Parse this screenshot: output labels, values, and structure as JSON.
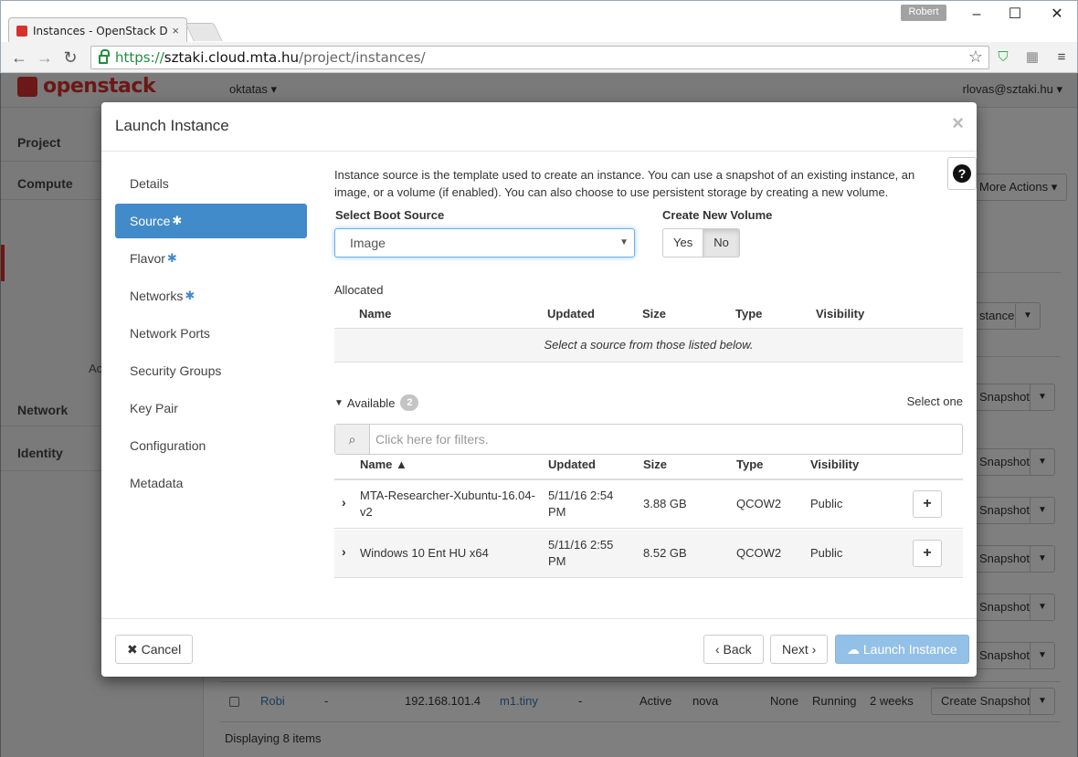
{
  "browser": {
    "tab_title": "Instances - OpenStack Da",
    "tab_close": "×",
    "profile": "Robert",
    "url_proto": "https://",
    "url_host": "sztaki.cloud.mta.hu",
    "url_path": "/project/instances/",
    "icons": [
      "back-arrow-icon",
      "forward-arrow-icon",
      "reload-icon",
      "lock-icon",
      "star-icon",
      "shield-icon",
      "extension-icon",
      "menu-icon"
    ]
  },
  "app": {
    "brand": "openstack",
    "project_switch": "oktatas ▾",
    "user": "rlovas@sztaki.hu ▾",
    "sidebar": {
      "project": "Project",
      "compute": "Compute",
      "network": "Network",
      "identity": "Identity",
      "stub": "Ac"
    },
    "more_actions": "More Actions ▾",
    "launch_stub": "stance",
    "create_snapshot": "Create Snapshot",
    "snapshot": "Snapshot",
    "last_row": {
      "name": "Robi",
      "image": "-",
      "ip": "192.168.101.4",
      "flavor": "m1.tiny",
      "keypair": "-",
      "status": "Active",
      "zone": "nova",
      "task": "None",
      "power": "Running",
      "age": "2 weeks"
    },
    "footer": "Displaying 8 items"
  },
  "modal": {
    "title": "Launch Instance",
    "close": "×",
    "help": "?",
    "nav": [
      {
        "label": "Details",
        "required": false
      },
      {
        "label": "Source",
        "required": true
      },
      {
        "label": "Flavor",
        "required": true
      },
      {
        "label": "Networks",
        "required": true
      },
      {
        "label": "Network Ports",
        "required": false
      },
      {
        "label": "Security Groups",
        "required": false
      },
      {
        "label": "Key Pair",
        "required": false
      },
      {
        "label": "Configuration",
        "required": false
      },
      {
        "label": "Metadata",
        "required": false
      }
    ],
    "active_step": "Source",
    "intro": "Instance source is the template used to create an instance. You can use a snapshot of an existing instance, an image, or a volume (if enabled). You can also choose to use persistent storage by creating a new volume.",
    "boot_source_label": "Select Boot Source",
    "boot_source_value": "Image",
    "create_volume_label": "Create New Volume",
    "volume_yes": "Yes",
    "volume_no": "No",
    "allocated": {
      "title": "Allocated",
      "columns": [
        "Name",
        "Updated",
        "Size",
        "Type",
        "Visibility"
      ],
      "empty": "Select a source from those listed below."
    },
    "available": {
      "title": "Available",
      "count": "2",
      "select_one": "Select one",
      "filter_placeholder": "Click here for filters.",
      "columns": [
        "Name ▲",
        "Updated",
        "Size",
        "Type",
        "Visibility"
      ],
      "rows": [
        {
          "name": "MTA-Researcher-Xubuntu-16.04-v2",
          "updated": "5/11/16 2:54 PM",
          "size": "3.88 GB",
          "type": "QCOW2",
          "visibility": "Public"
        },
        {
          "name": "Windows 10 Ent HU x64",
          "updated": "5/11/16 2:55 PM",
          "size": "8.52 GB",
          "type": "QCOW2",
          "visibility": "Public"
        }
      ]
    },
    "footer": {
      "cancel": "Cancel",
      "back": "‹ Back",
      "next": "Next ›",
      "launch": "Launch Instance"
    }
  }
}
